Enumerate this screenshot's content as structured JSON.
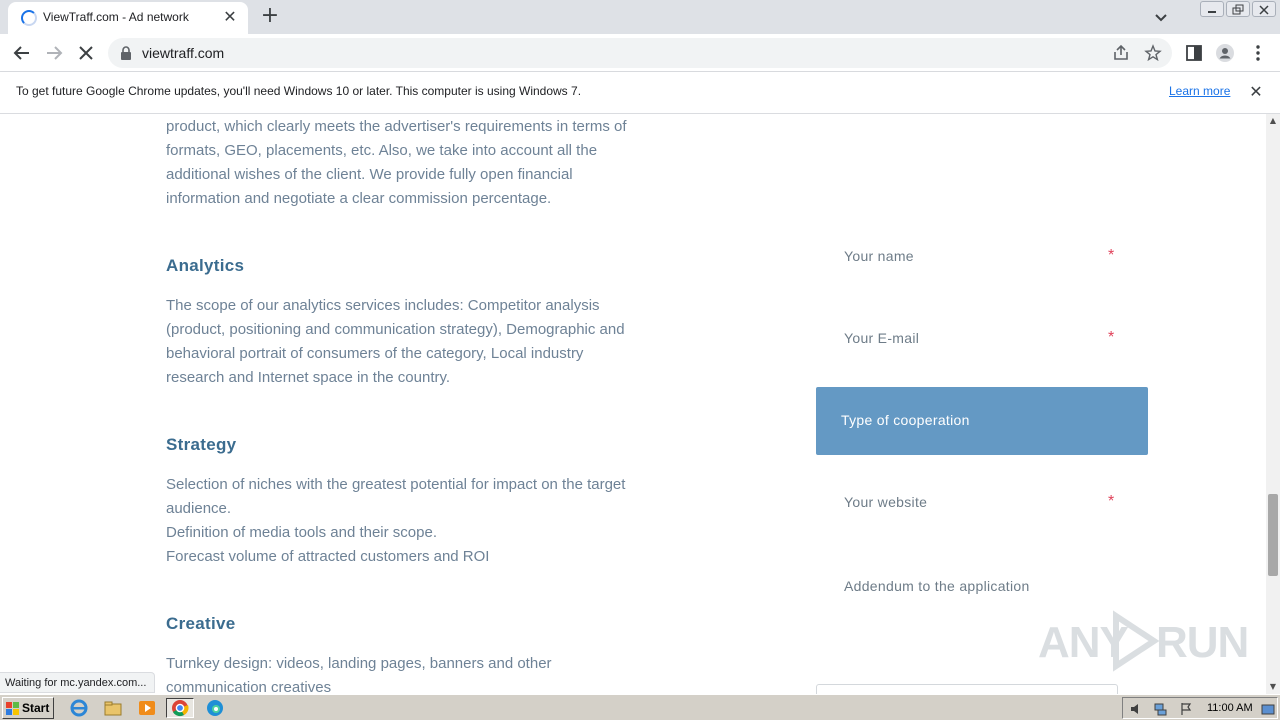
{
  "browser": {
    "tab_title": "ViewTraff.com - Ad network",
    "tab_close": "✕",
    "new_tab": "+",
    "url": "viewtraff.com"
  },
  "infobar": {
    "message": "To get future Google Chrome updates, you'll need Windows 10 or later. This computer is using Windows 7.",
    "learn_more": "Learn more",
    "close": "✕"
  },
  "content": {
    "intro_paragraph": [
      "product, which clearly meets the advertiser's requirements in terms of",
      "formats, GEO, placements, etc. Also, we take into account all the",
      "additional wishes of the client. We provide fully open financial",
      "information and negotiate a clear commission percentage."
    ],
    "sections": [
      {
        "title": "Analytics",
        "lines": [
          "The scope of our analytics services includes: Competitor analysis",
          "(product, positioning and communication strategy), Demographic and",
          "behavioral portrait of consumers of the category, Local industry",
          "research and Internet space in the country."
        ]
      },
      {
        "title": "Strategy",
        "lines": [
          "Selection of niches with the greatest potential for impact on the target",
          "audience.",
          "Definition of media tools and their scope.",
          "Forecast volume of attracted customers and ROI"
        ]
      },
      {
        "title": "Creative",
        "lines": [
          "Turnkey design: videos, landing pages, banners and other",
          "communication creatives"
        ]
      }
    ]
  },
  "form": {
    "name_label": "Your name",
    "email_label": "Your E-mail",
    "cooperation_label": "Type of cooperation",
    "website_label": "Your website",
    "addendum_label": "Addendum to the application",
    "required_mark": "*"
  },
  "status_text": "Waiting for mc.yandex.com...",
  "watermark": {
    "left": "ANY",
    "right": "RUN"
  },
  "taskbar": {
    "start_label": "Start",
    "clock": "11:00 AM"
  },
  "colors": {
    "heading": "#3b6c8f",
    "body_text": "#6e8296",
    "cooperation_bg": "#6499c4",
    "required": "#e0425a",
    "link": "#1a73e8"
  }
}
